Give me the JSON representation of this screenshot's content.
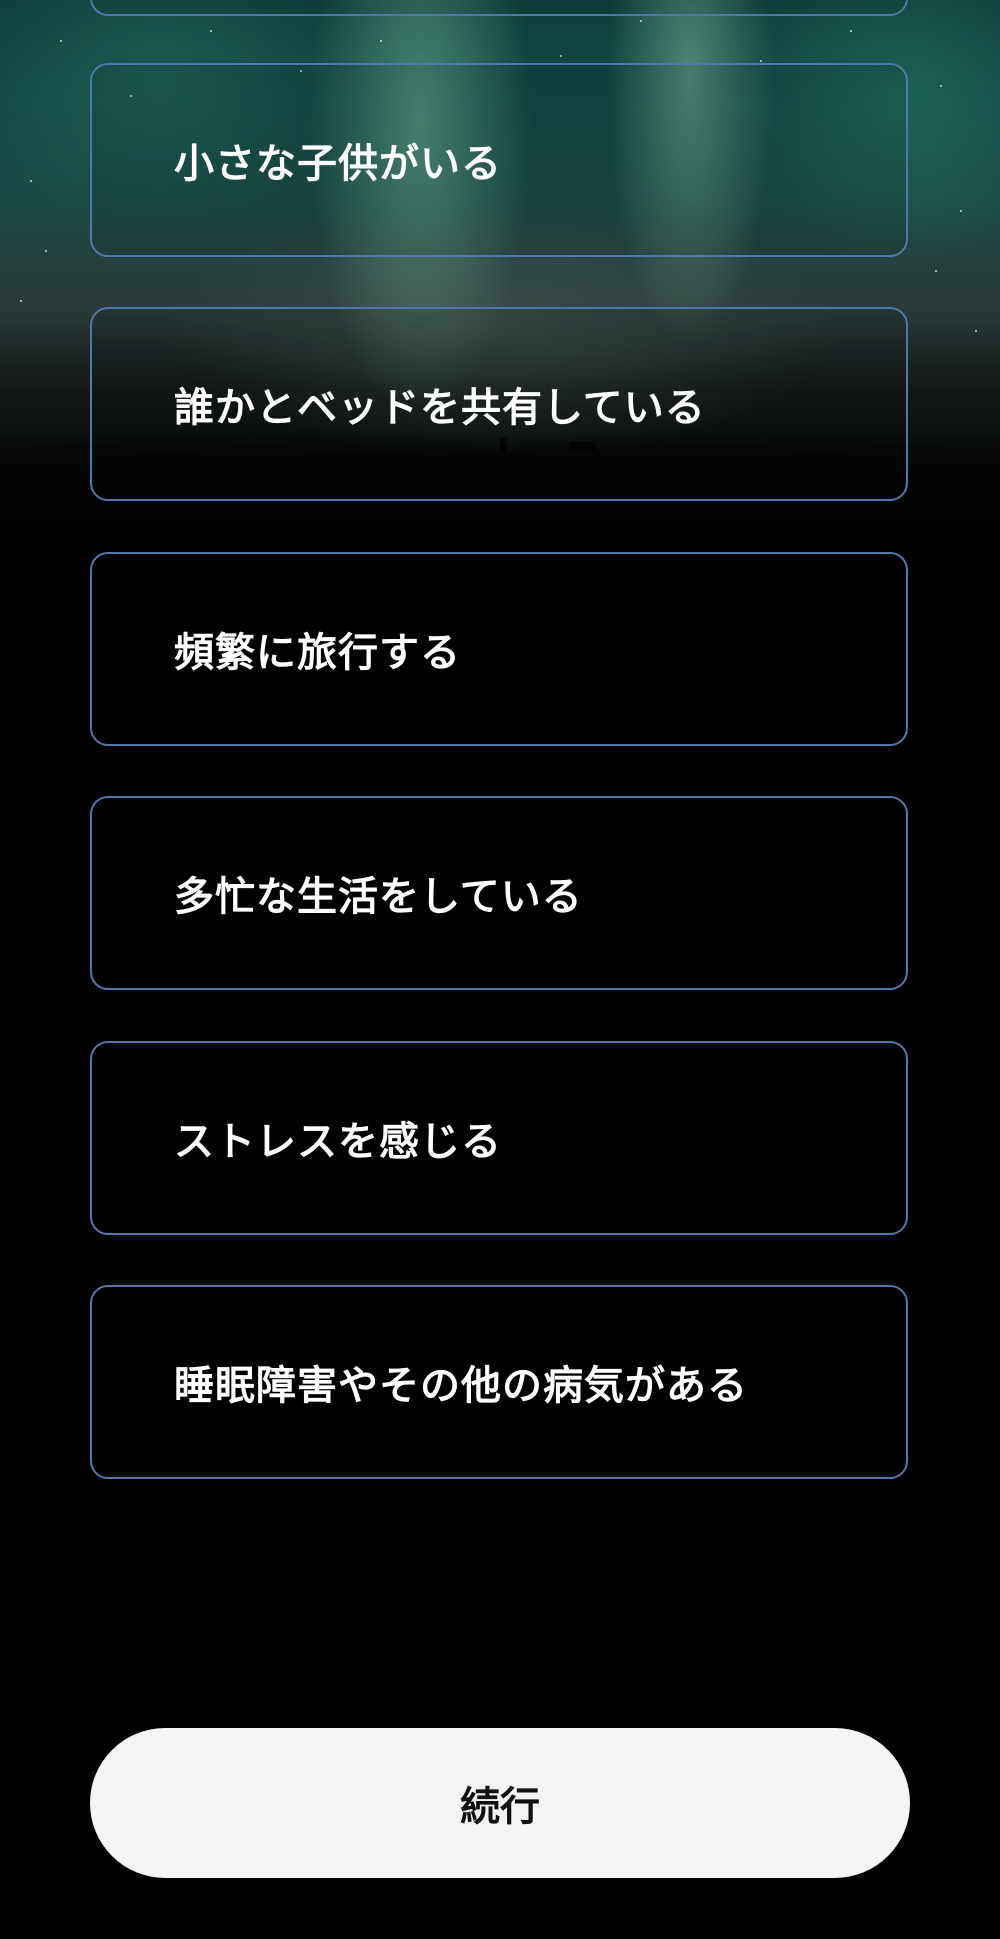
{
  "options": [
    {
      "label": ""
    },
    {
      "label": "小さな子供がいる"
    },
    {
      "label": "誰かとベッドを共有している"
    },
    {
      "label": "頻繁に旅行する"
    },
    {
      "label": "多忙な生活をしている"
    },
    {
      "label": "ストレスを感じる"
    },
    {
      "label": "睡眠障害やその他の病気がある"
    }
  ],
  "continue_button": {
    "label": "続行"
  },
  "colors": {
    "background": "#000000",
    "option_border": "#4f78ad",
    "option_text": "#ffffff",
    "button_bg": "#f3f4f6",
    "button_text": "#111111"
  }
}
